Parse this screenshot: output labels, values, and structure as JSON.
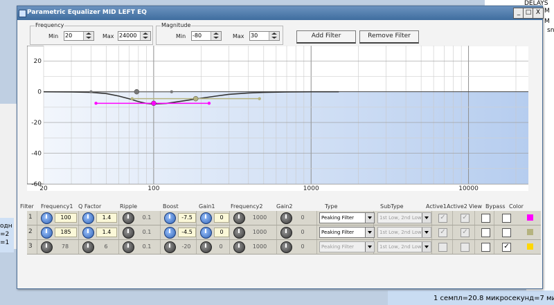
{
  "background": {
    "top_right_text": "DELAYS",
    "letter_m1": "M",
    "letter_m2": "M",
    "letter_sn": "sn",
    "left_lines": [
      "одн",
      "=2",
      "=1"
    ],
    "bottom_text": "1 семпл=20.8 микросекунд=7 мил"
  },
  "window": {
    "title": "Parametric Equalizer MID LEFT EQ",
    "minimize": "_",
    "maximize": "□",
    "close": "X"
  },
  "frequency": {
    "label": "Frequency",
    "min_label": "Min",
    "min_value": "20",
    "max_label": "Max",
    "max_value": "24000"
  },
  "magnitude": {
    "label": "Magnitude",
    "min_label": "Min",
    "min_value": "-80",
    "max_label": "Max",
    "max_value": "30"
  },
  "buttons": {
    "add": "Add Filter",
    "remove": "Remove Filter"
  },
  "chart_data": {
    "type": "line",
    "xscale": "log",
    "xlim": [
      20,
      24000
    ],
    "ylim": [
      -60,
      30
    ],
    "y_ticks": [
      "20",
      "0",
      "-20",
      "-40",
      "-60"
    ],
    "x_ticks": [
      "20",
      "100",
      "1000",
      "10000"
    ],
    "x_tick_values": [
      20,
      100,
      1000,
      10000
    ],
    "y_tick_values": [
      20,
      0,
      -20,
      -40,
      -60
    ],
    "series": [
      {
        "x": [
          20,
          30,
          40,
          50,
          60,
          70,
          80,
          90,
          100,
          120,
          140,
          170,
          200,
          250,
          300,
          400,
          500,
          700,
          1000,
          1500
        ],
        "y": [
          0,
          -0.1,
          -0.4,
          -1.2,
          -2.8,
          -4.6,
          -6.4,
          -7.6,
          -8.0,
          -7.6,
          -6.6,
          -5.3,
          -4.2,
          -2.8,
          -1.7,
          -0.8,
          -0.4,
          -0.1,
          0,
          0
        ]
      }
    ],
    "filters": [
      {
        "freq": 100,
        "gain": -7.5,
        "left": 43,
        "right": 225,
        "color": "#ff00ff"
      },
      {
        "freq": 185,
        "gain": -4.5,
        "left": 73,
        "right": 470,
        "color": "#b5b37f"
      },
      {
        "freq": 78,
        "gain": 0,
        "left": 40,
        "right": 130,
        "color": "#777777"
      }
    ]
  },
  "table": {
    "headers": [
      "Filter",
      "Frequency1",
      "Q Factor",
      "Ripple",
      "Boost",
      "Gain1",
      "Frequency2",
      "Gain2",
      "Type",
      "SubType",
      "Active1",
      "Active2",
      "View",
      "Bypass",
      "Color"
    ],
    "rows": [
      {
        "n": "1",
        "freq1": "100",
        "q": "1.4",
        "ripple": "0.1",
        "boost": "-7.5",
        "gain1": "0",
        "freq2": "1000",
        "gain2": "0",
        "type": "Peaking Filter",
        "subtype": "1st Low, 2nd Low",
        "active1": "✓",
        "active2": "✓",
        "view": "",
        "bypass": "",
        "color": "#ff00ff",
        "editable": true
      },
      {
        "n": "2",
        "freq1": "185",
        "q": "1.4",
        "ripple": "0.1",
        "boost": "-4.5",
        "gain1": "0",
        "freq2": "1000",
        "gain2": "0",
        "type": "Peaking Filter",
        "subtype": "1st Low, 2nd Low",
        "active1": "✓",
        "active2": "✓",
        "view": "",
        "bypass": "",
        "color": "#b5b37f",
        "editable": true
      },
      {
        "n": "3",
        "freq1": "78",
        "q": "6",
        "ripple": "0.1",
        "boost": "-20",
        "gain1": "0",
        "freq2": "1000",
        "gain2": "0",
        "type": "Peaking Filter",
        "subtype": "1st Low, 2nd Low",
        "active1": "",
        "active2": "",
        "view": "",
        "bypass": "✓",
        "color": "#ffd700",
        "editable": false
      }
    ]
  }
}
